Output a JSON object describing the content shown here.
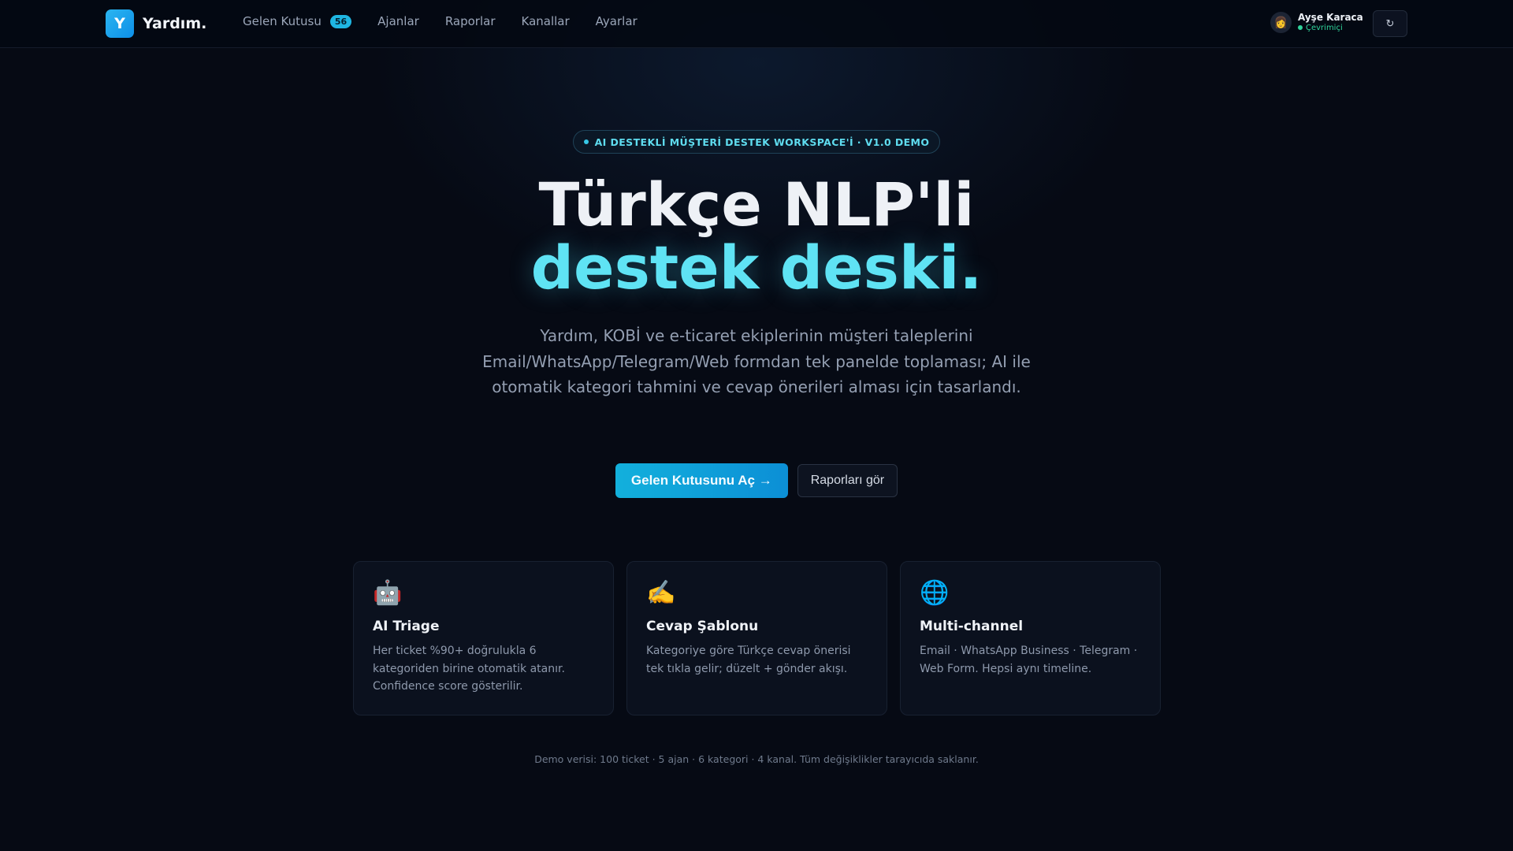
{
  "brand": {
    "logo_letter": "Y",
    "name": "Yardım."
  },
  "nav": {
    "items": [
      {
        "label": "Gelen Kutusu",
        "badge": "56"
      },
      {
        "label": "Ajanlar"
      },
      {
        "label": "Raporlar"
      },
      {
        "label": "Kanallar"
      },
      {
        "label": "Ayarlar"
      }
    ]
  },
  "user": {
    "name": "Ayşe Karaca",
    "status": "Çevrimiçi",
    "avatar_icon": "woman-avatar-icon",
    "status_color": "#2fd39a"
  },
  "toolbar": {
    "refresh_symbol": "↻",
    "refresh_icon": "refresh-icon"
  },
  "hero": {
    "pill": "AI DESTEKLİ MÜŞTERİ DESTEK WORKSPACE'İ · V1.0 DEMO",
    "title_line1": "Türkçe NLP'li",
    "title_line2": "destek deski.",
    "description": "Yardım, KOBİ ve e-ticaret ekiplerinin müşteri taleplerini Email/WhatsApp/Telegram/Web formdan tek panelde toplaması; AI ile otomatik kategori tahmini ve cevap önerileri alması için tasarlandı.",
    "primary_cta": "Gelen Kutusunu Aç →",
    "secondary_cta": "Raporları gör"
  },
  "features": [
    {
      "icon": "🤖",
      "icon_name": "robot-icon",
      "title": "AI Triage",
      "description": "Her ticket %90+ doğrulukla 6 kategoriden birine otomatik atanır. Confidence score gösterilir."
    },
    {
      "icon": "✍️",
      "icon_name": "writing-hand-icon",
      "title": "Cevap Şablonu",
      "description": "Kategoriye göre Türkçe cevap önerisi tek tıkla gelir; düzelt + gönder akışı."
    },
    {
      "icon": "🌐",
      "icon_name": "globe-icon",
      "title": "Multi-channel",
      "description": "Email · WhatsApp Business · Telegram · Web Form. Hepsi aynı timeline."
    }
  ],
  "footer_note": "Demo verisi: 100 ticket · 5 ajan · 6 kategori · 4 kanal. Tüm değişiklikler tarayıcıda saklanır.",
  "colors": {
    "accent": "#5fe3f4",
    "primary_button": "#12b0dc",
    "background": "#060a14",
    "badge": "#1fb6e2"
  }
}
